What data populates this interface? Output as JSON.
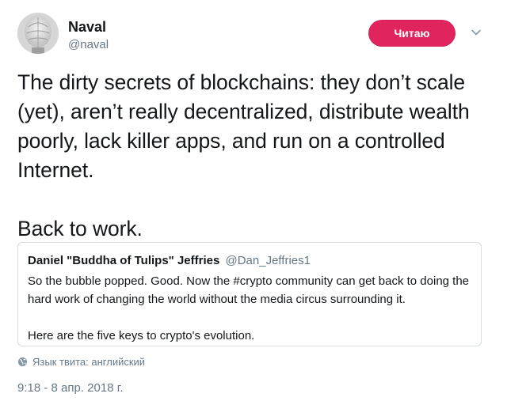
{
  "author": {
    "name": "Naval",
    "handle": "@naval"
  },
  "follow_button": {
    "label": "Читаю",
    "color": "#e0245e"
  },
  "menu": {
    "icon": "chevron-down-icon"
  },
  "tweet": {
    "paragraph1": "The dirty secrets of blockchains: they don’t scale (yet), aren’t really decentralized, distribute wealth poorly, lack killer apps, and run on a controlled Internet.",
    "paragraph2": "Back to work."
  },
  "quoted_tweet": {
    "author_name": "Daniel \"Buddha of Tulips\" Jeffries",
    "author_handle": "@Dan_Jeffries1",
    "paragraph1": "So the bubble popped. Good. Now the #crypto community can get back to doing the hard work of changing the world without the media circus surrounding it.",
    "paragraph2": "Here are the five keys to crypto's evolution."
  },
  "language": {
    "icon": "globe-icon",
    "text": "Язык твита: английский"
  },
  "timestamp": "9:18 - 8 апр. 2018 г."
}
